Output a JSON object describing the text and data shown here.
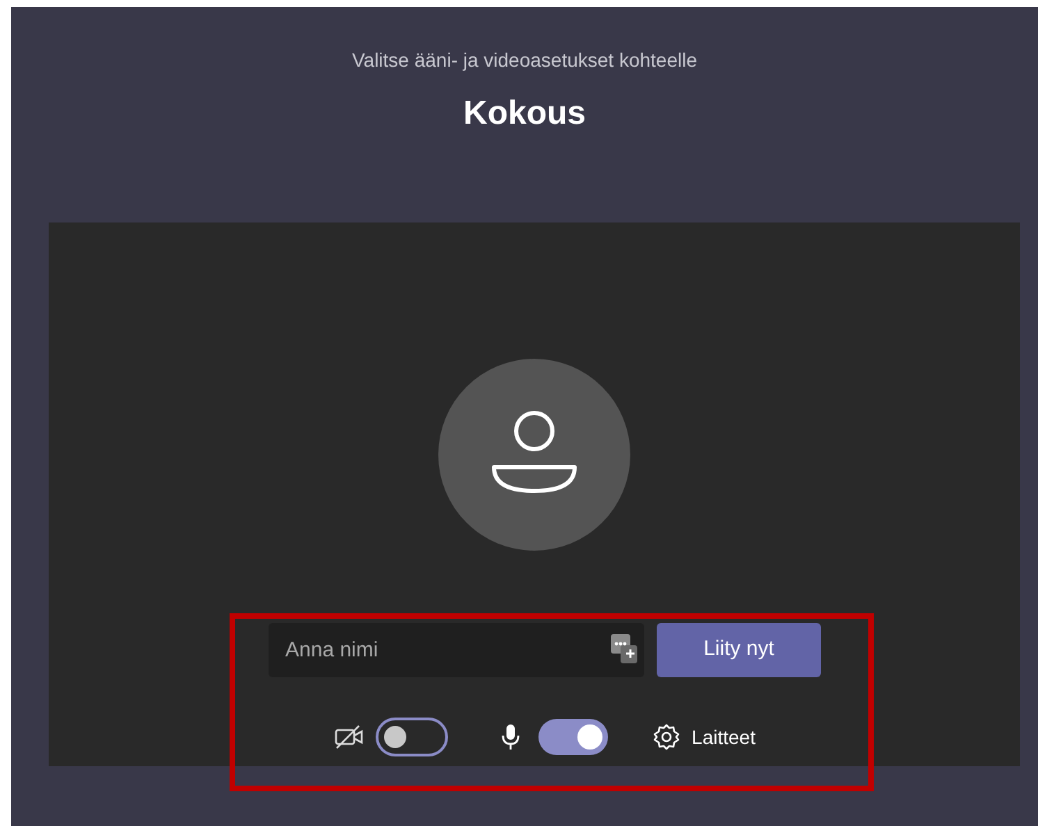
{
  "header": {
    "subtitle": "Valitse ääni- ja videoasetukset kohteelle",
    "title": "Kokous"
  },
  "name_field": {
    "placeholder": "Anna nimi"
  },
  "join_button": {
    "label": "Liity nyt"
  },
  "toggles": [
    {
      "kind": "camera",
      "on": false
    },
    {
      "kind": "microphone",
      "on": true
    }
  ],
  "devices_button": {
    "label": "Laitteet"
  }
}
